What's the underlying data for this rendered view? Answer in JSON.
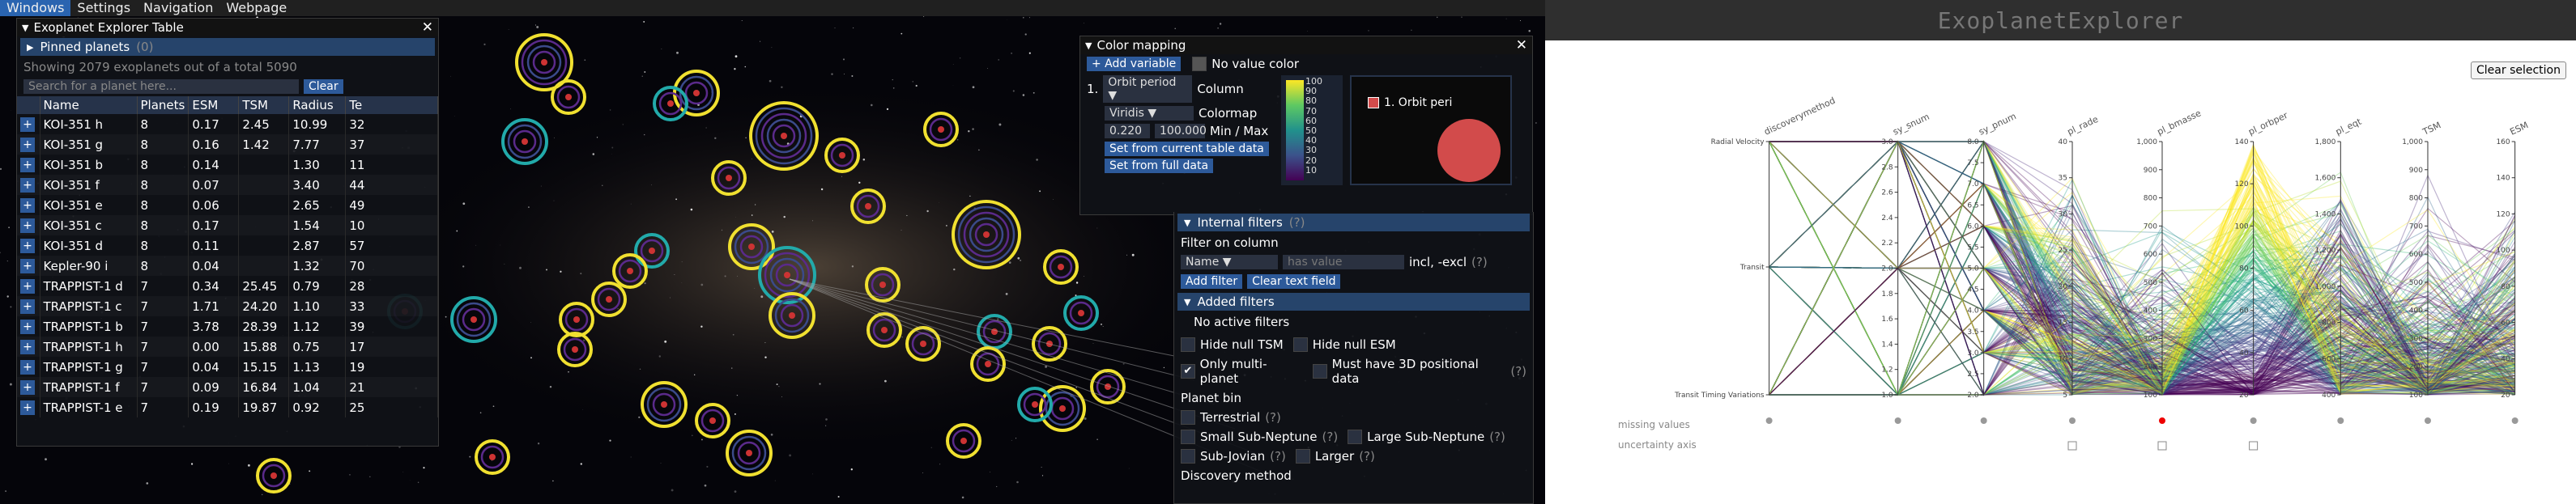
{
  "menu": [
    "Windows",
    "Settings",
    "Navigation",
    "Webpage"
  ],
  "table_panel": {
    "title": "Exoplanet Explorer Table",
    "pinned_label": "Pinned planets",
    "pinned_count": "(0)",
    "showing_text": "Showing 2079 exoplanets out of a total 5090",
    "search_placeholder": "Search for a planet here...",
    "clear_label": "Clear",
    "columns": [
      "Name",
      "Planets",
      "ESM",
      "TSM",
      "Radius",
      "Te"
    ],
    "rows": [
      [
        "KOI-351 h",
        "8",
        "0.17",
        "2.45",
        "10.99",
        "32"
      ],
      [
        "KOI-351 g",
        "8",
        "0.16",
        "1.42",
        "7.77",
        "37"
      ],
      [
        "KOI-351 b",
        "8",
        "0.14",
        "",
        "1.30",
        "11"
      ],
      [
        "KOI-351 f",
        "8",
        "0.07",
        "",
        "3.40",
        "44"
      ],
      [
        "KOI-351 e",
        "8",
        "0.06",
        "",
        "2.65",
        "49"
      ],
      [
        "KOI-351 c",
        "8",
        "0.17",
        "",
        "1.54",
        "10"
      ],
      [
        "KOI-351 d",
        "8",
        "0.11",
        "",
        "2.87",
        "57"
      ],
      [
        "Kepler-90 i",
        "8",
        "0.04",
        "",
        "1.32",
        "70"
      ],
      [
        "TRAPPIST-1 d",
        "7",
        "0.34",
        "25.45",
        "0.79",
        "28"
      ],
      [
        "TRAPPIST-1 c",
        "7",
        "1.71",
        "24.20",
        "1.10",
        "33"
      ],
      [
        "TRAPPIST-1 b",
        "7",
        "3.78",
        "28.39",
        "1.12",
        "39"
      ],
      [
        "TRAPPIST-1 h",
        "7",
        "0.00",
        "15.88",
        "0.75",
        "17"
      ],
      [
        "TRAPPIST-1 g",
        "7",
        "0.04",
        "15.15",
        "1.13",
        "19"
      ],
      [
        "TRAPPIST-1 f",
        "7",
        "0.09",
        "16.84",
        "1.04",
        "21"
      ],
      [
        "TRAPPIST-1 e",
        "7",
        "0.19",
        "19.87",
        "0.92",
        "25"
      ]
    ]
  },
  "color_panel": {
    "title": "Color mapping",
    "add_variable": "+ Add variable",
    "no_value_color": "No value color",
    "index": "1.",
    "column_value": "Orbit period",
    "column_label": "Column",
    "colormap_value": "Viridis",
    "colormap_label": "Colormap",
    "min": "0.220",
    "max": "100.000",
    "minmax_label": "Min / Max",
    "set_table": "Set from current table data",
    "set_full": "Set from full data",
    "ticks": [
      "100",
      "90",
      "80",
      "70",
      "60",
      "50",
      "40",
      "30",
      "20",
      "10"
    ],
    "legend_label": "1. Orbit peri"
  },
  "filter_panel": {
    "internal_filters": "Internal filters",
    "help": "(?)",
    "filter_on_column": "Filter on column",
    "column_value": "Name",
    "has_value_placeholder": "has value",
    "incl_excl": "incl, -excl",
    "add_filter": "Add filter",
    "clear_text": "Clear text field",
    "added_filters": "Added filters",
    "no_active": "No active filters",
    "hide_null_tsm": "Hide null TSM",
    "hide_null_esm": "Hide null ESM",
    "only_multi": "Only multi-planet",
    "must_3d": "Must have 3D positional data",
    "planet_bin": "Planet bin",
    "terrestrial": "Terrestrial",
    "small_sub": "Small Sub-Neptune",
    "large_sub": "Large Sub-Neptune",
    "sub_jovian": "Sub-Jovian",
    "larger": "Larger",
    "discovery_method": "Discovery method"
  },
  "right": {
    "title": "ExoplanetExplorer",
    "clear_selection": "Clear selection",
    "missing_values": "missing values",
    "uncertainty_axis": "uncertainty axis"
  },
  "chart_data": {
    "type": "parallel-coordinates",
    "axes": [
      {
        "name": "discoverymethod",
        "ticks": [
          "Radial Velocity",
          "Transit",
          "Transit Timing Variations"
        ]
      },
      {
        "name": "sy_snum",
        "ticks": [
          "3.0",
          "2.8",
          "2.6",
          "2.4",
          "2.2",
          "2.0",
          "1.8",
          "1.6",
          "1.4",
          "1.2",
          "1.0"
        ]
      },
      {
        "name": "sy_pnum",
        "ticks": [
          "8.0",
          "7.5",
          "7.0",
          "6.5",
          "6.0",
          "5.5",
          "5.0",
          "4.5",
          "4.0",
          "3.5",
          "3.0",
          "2.5",
          "2.0"
        ]
      },
      {
        "name": "pl_rade",
        "ticks": [
          "40",
          "35",
          "30",
          "25",
          "20",
          "15",
          "10",
          "5"
        ]
      },
      {
        "name": "pl_bmasse",
        "ticks": [
          "1,000",
          "900",
          "800",
          "700",
          "600",
          "500",
          "400",
          "300",
          "200",
          "100"
        ]
      },
      {
        "name": "pl_orbper",
        "ticks": [
          "140",
          "120",
          "100",
          "80",
          "60",
          "40",
          "20"
        ]
      },
      {
        "name": "pl_eqt",
        "ticks": [
          "1,800",
          "1,600",
          "1,400",
          "1,200",
          "1,000",
          "800",
          "600",
          "400"
        ]
      },
      {
        "name": "TSM",
        "ticks": [
          "1,000",
          "900",
          "800",
          "700",
          "600",
          "500",
          "400",
          "300",
          "200",
          "100"
        ]
      },
      {
        "name": "ESM",
        "ticks": [
          "160",
          "140",
          "120",
          "100",
          "80",
          "60",
          "40",
          "20"
        ]
      }
    ],
    "colormap": "Viridis"
  }
}
